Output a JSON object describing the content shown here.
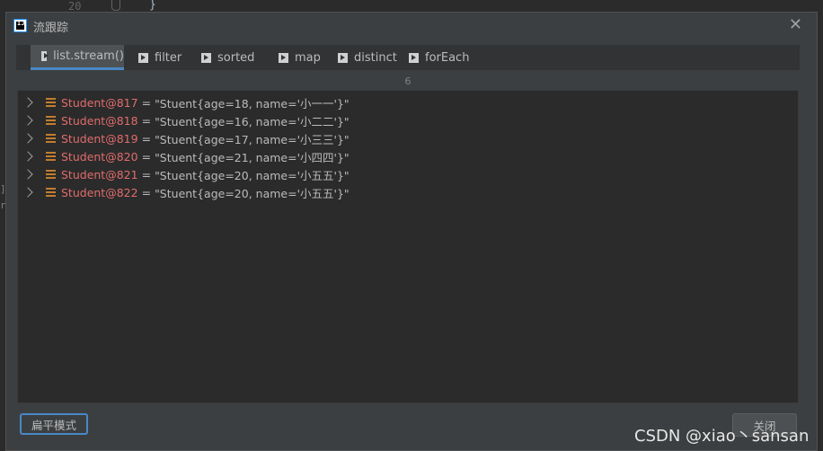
{
  "background_editor": {
    "line_number": "20",
    "code_text": "}",
    "left_edge_fragments": [
      "]",
      "r"
    ]
  },
  "dialog": {
    "title": "流跟踪",
    "close_icon": "close-icon",
    "tabs": [
      {
        "label": "list.stream()",
        "active": true
      },
      {
        "label": "filter",
        "active": false
      },
      {
        "label": "sorted",
        "active": false
      },
      {
        "label": "map",
        "active": false
      },
      {
        "label": "distinct",
        "active": false
      },
      {
        "label": "forEach",
        "active": false
      }
    ],
    "item_count": "6",
    "items": [
      {
        "name": "Student@817",
        "value": "\"Stuent{age=18, name='小一一'}\""
      },
      {
        "name": "Student@818",
        "value": "\"Stuent{age=16, name='小二二'}\""
      },
      {
        "name": "Student@819",
        "value": "\"Stuent{age=17, name='小三三'}\""
      },
      {
        "name": "Student@820",
        "value": "\"Stuent{age=21, name='小四四'}\""
      },
      {
        "name": "Student@821",
        "value": "\"Stuent{age=20, name='小五五'}\""
      },
      {
        "name": "Student@822",
        "value": "\"Stuent{age=20, name='小五五'}\""
      }
    ],
    "flat_mode_button": "扁平模式",
    "close_button": "关闭"
  },
  "watermark": "CSDN @xiao丶sansan",
  "colors": {
    "dialog_bg": "#3c3f41",
    "panel_bg": "#2b2b2b",
    "accent": "#4a88c7",
    "object_name": "#e06c6c",
    "object_icon": "#c27d2e"
  }
}
